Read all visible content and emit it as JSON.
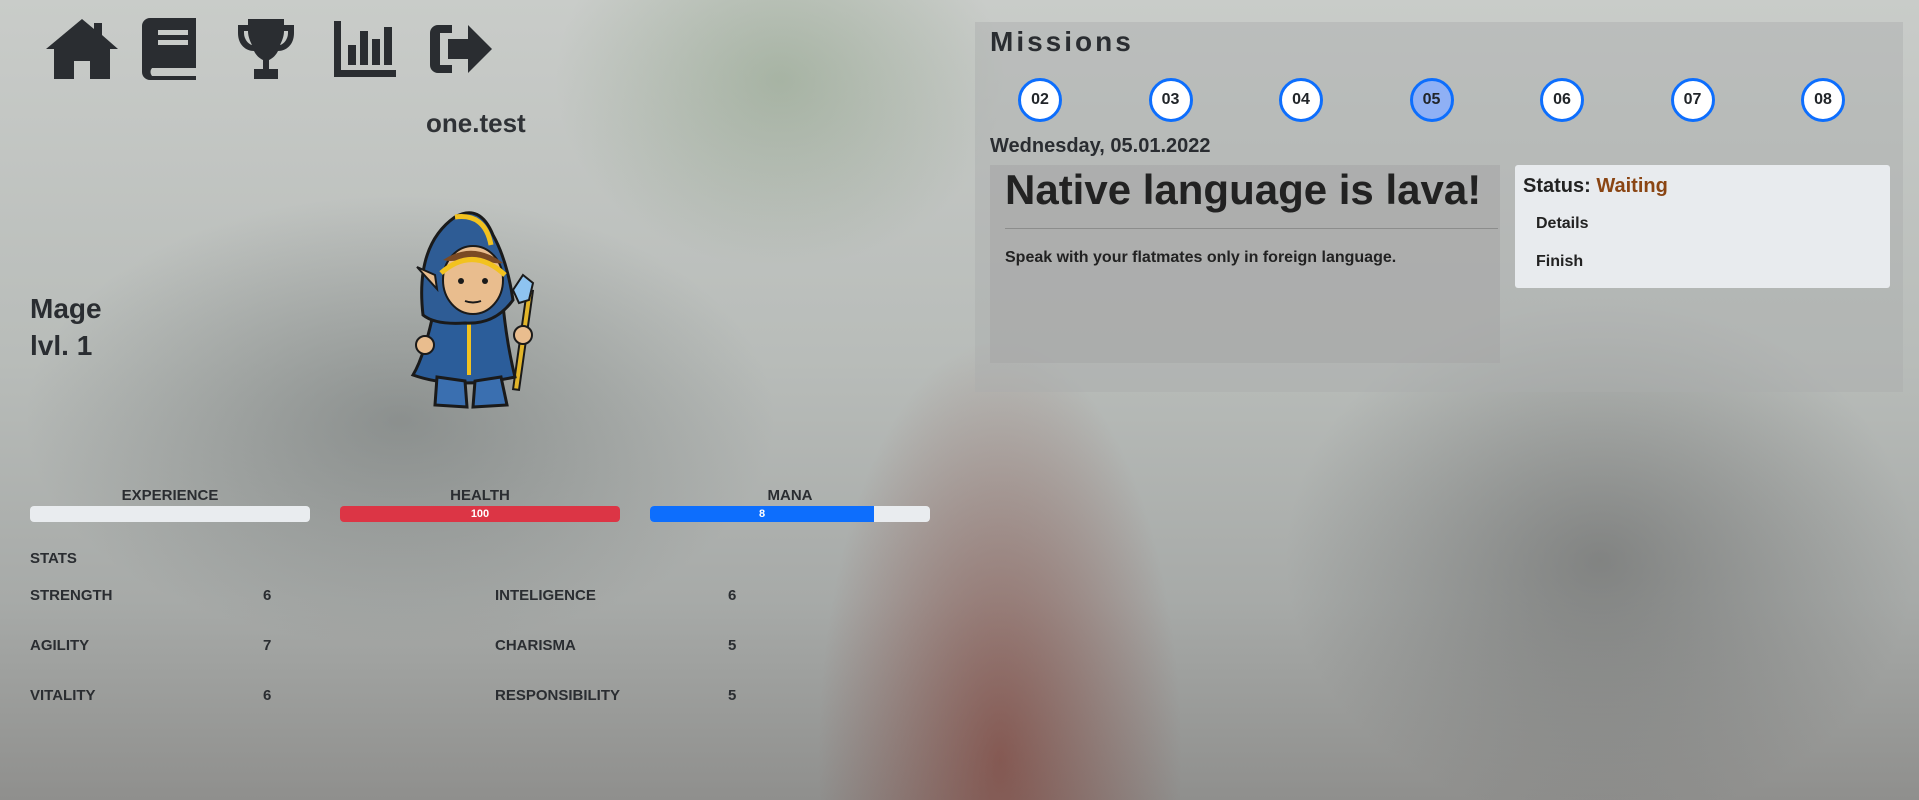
{
  "nav": {
    "icons": [
      "home-icon",
      "book-icon",
      "trophy-icon",
      "chart-bar-icon",
      "sign-out-icon"
    ]
  },
  "user": {
    "name": "one.test",
    "class": "Mage",
    "level": "lvl. 1"
  },
  "bars": {
    "experience": {
      "label": "EXPERIENCE",
      "value": "",
      "fraction": 0,
      "color": "#e9ecef"
    },
    "health": {
      "label": "HEALTH",
      "value": "100",
      "fraction": 1.0,
      "color": "#dc3545"
    },
    "mana": {
      "label": "MANA",
      "value": "8",
      "fraction": 0.8,
      "color": "#0d6efd"
    }
  },
  "stats": {
    "title": "STATS",
    "left": [
      {
        "name": "STRENGTH",
        "value": "6"
      },
      {
        "name": "AGILITY",
        "value": "7"
      },
      {
        "name": "VITALITY",
        "value": "6"
      }
    ],
    "right": [
      {
        "name": "INTELIGENCE",
        "value": "6"
      },
      {
        "name": "CHARISMA",
        "value": "5"
      },
      {
        "name": "RESPONSIBILITY",
        "value": "5"
      }
    ]
  },
  "missions": {
    "title": "Missions",
    "days": [
      "02",
      "03",
      "04",
      "05",
      "06",
      "07",
      "08"
    ],
    "active_day": "05",
    "date": "Wednesday, 05.01.2022",
    "mission_title": "Native language is lava!",
    "mission_desc": "Speak with your flatmates only in foreign language.",
    "status_label": "Status:",
    "status_value": "Waiting",
    "status_color": "#8a4513",
    "details_label": "Details",
    "finish_label": "Finish"
  }
}
